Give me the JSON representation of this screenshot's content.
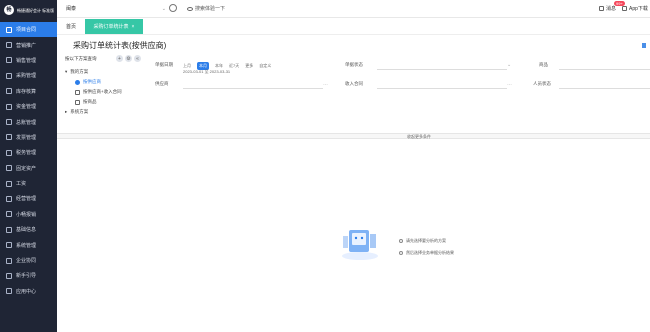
{
  "sidebar": {
    "brand": "畅捷通好会计 标准版",
    "logo": "畅",
    "items": [
      {
        "label": "项目合同",
        "icon": "contract-icon",
        "active": true
      },
      {
        "label": "营销推广",
        "icon": "marketing-icon"
      },
      {
        "label": "销售管理",
        "icon": "sales-icon"
      },
      {
        "label": "采购管理",
        "icon": "purchase-icon"
      },
      {
        "label": "库存核算",
        "icon": "inventory-icon"
      },
      {
        "label": "资金管理",
        "icon": "fund-icon"
      },
      {
        "label": "总账管理",
        "icon": "ledger-icon"
      },
      {
        "label": "发票管理",
        "icon": "invoice-icon"
      },
      {
        "label": "税务管理",
        "icon": "tax-icon"
      },
      {
        "label": "固定资产",
        "icon": "asset-icon"
      },
      {
        "label": "工资",
        "icon": "salary-icon"
      },
      {
        "label": "经营管理",
        "icon": "operation-icon"
      },
      {
        "label": "小畅报销",
        "icon": "reimburse-icon"
      },
      {
        "label": "基础信息",
        "icon": "base-info-icon"
      },
      {
        "label": "系统管理",
        "icon": "system-icon"
      },
      {
        "label": "企业协同",
        "icon": "collab-icon"
      },
      {
        "label": "新手引导",
        "icon": "guide-icon"
      },
      {
        "label": "应用中心",
        "icon": "app-center-icon"
      }
    ]
  },
  "topbar": {
    "company": "闽泰",
    "search_label": "搜索体验一下",
    "message_label": "消息",
    "message_badge": "99+",
    "app_label": "App下载"
  },
  "tabs": {
    "home": "首页",
    "active": "采购订单统计表",
    "close": "×"
  },
  "page": {
    "title": "采购订单统计表(按供应商)"
  },
  "scheme": {
    "title": "按以下方案查询",
    "add": "+",
    "setting": "⚙",
    "collapse": "«",
    "groups": [
      {
        "label": "我的方案",
        "children": [
          "按供应商",
          "按供应商+收入合同",
          "按商品"
        ]
      },
      {
        "label": "系统方案",
        "children": []
      }
    ]
  },
  "filters": {
    "date_label": "单据日期",
    "quick": [
      "上月",
      "本月",
      "本年",
      "近7天",
      "更多",
      "自定义"
    ],
    "quick_active": "本月",
    "date_range": "2023-03-01 至 2023-03-31",
    "status_label": "单据状态",
    "goods_label": "商品",
    "supplier_label": "供应商",
    "income_contract_label": "收入合同",
    "person_status_label": "人员状态"
  },
  "collapse_text": "收起更多条件",
  "empty": {
    "tips": [
      "请先选择要分析的方案",
      "然后选择业务单据分析结果"
    ]
  }
}
